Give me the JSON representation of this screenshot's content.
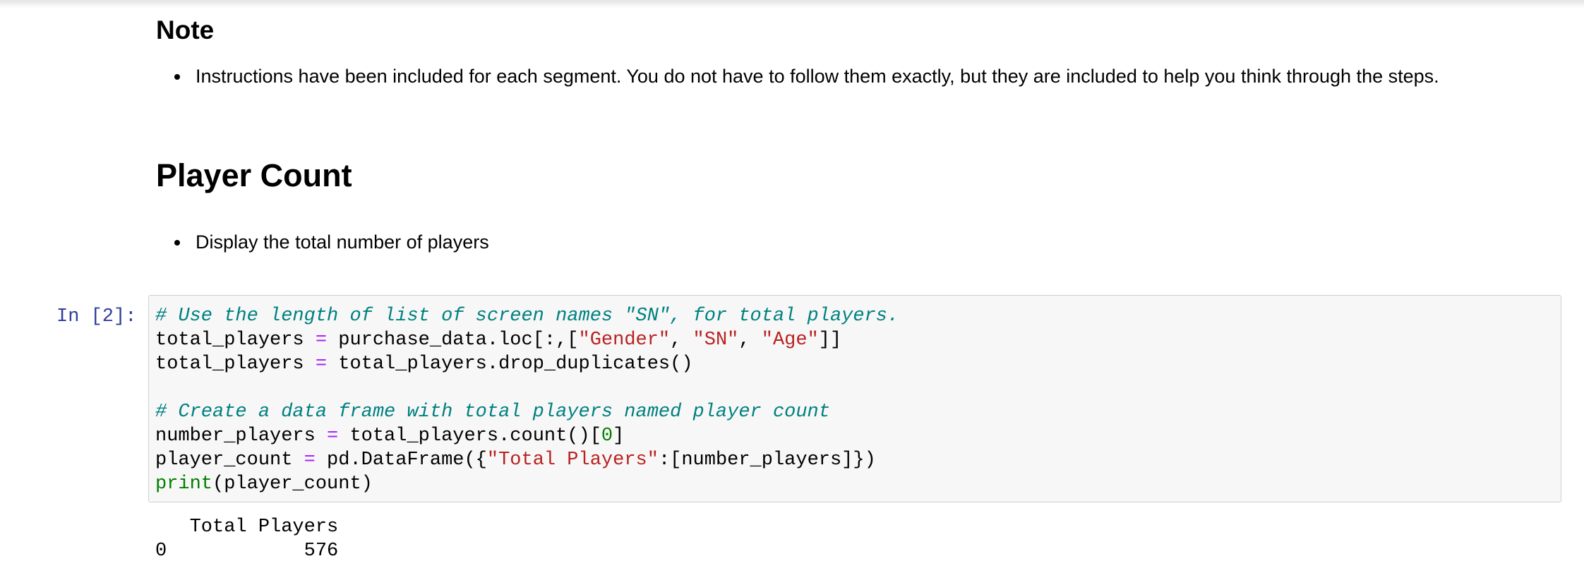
{
  "note": {
    "heading": "Note",
    "bullets": [
      "Instructions have been included for each segment. You do not have to follow them exactly, but they are included to help you think through the steps."
    ]
  },
  "player_count": {
    "heading": "Player Count",
    "bullets": [
      "Display the total number of players"
    ]
  },
  "cell": {
    "prompt": "In [2]:",
    "lines": [
      [
        {
          "t": "# Use the length of list of screen names \"SN\", for total players.",
          "c": "cm"
        }
      ],
      [
        {
          "t": "total_players "
        },
        {
          "t": "=",
          "c": "op"
        },
        {
          "t": " purchase_data.loc[:,["
        },
        {
          "t": "\"Gender\"",
          "c": "st"
        },
        {
          "t": ", "
        },
        {
          "t": "\"SN\"",
          "c": "st"
        },
        {
          "t": ", "
        },
        {
          "t": "\"Age\"",
          "c": "st"
        },
        {
          "t": "]]"
        }
      ],
      [
        {
          "t": "total_players "
        },
        {
          "t": "=",
          "c": "op"
        },
        {
          "t": " total_players.drop_duplicates()"
        }
      ],
      [
        {
          "t": ""
        }
      ],
      [
        {
          "t": "# Create a data frame with total players named player count",
          "c": "cm"
        }
      ],
      [
        {
          "t": "number_players "
        },
        {
          "t": "=",
          "c": "op"
        },
        {
          "t": " total_players.count()["
        },
        {
          "t": "0",
          "c": "nm"
        },
        {
          "t": "]"
        }
      ],
      [
        {
          "t": "player_count "
        },
        {
          "t": "=",
          "c": "op"
        },
        {
          "t": " pd.DataFrame({"
        },
        {
          "t": "\"Total Players\"",
          "c": "st"
        },
        {
          "t": ":[number_players]})"
        }
      ],
      [
        {
          "t": "print",
          "c": "nb"
        },
        {
          "t": "(player_count)"
        }
      ]
    ]
  },
  "output": {
    "lines": [
      "   Total Players",
      "0            576"
    ]
  },
  "colors": {
    "comment": "#008080",
    "string": "#ba2121",
    "operator": "#aa22ff",
    "builtin": "#008000",
    "prompt": "#303f9f",
    "cell_background": "#f7f7f7",
    "cell_border": "#cfcfcf"
  }
}
